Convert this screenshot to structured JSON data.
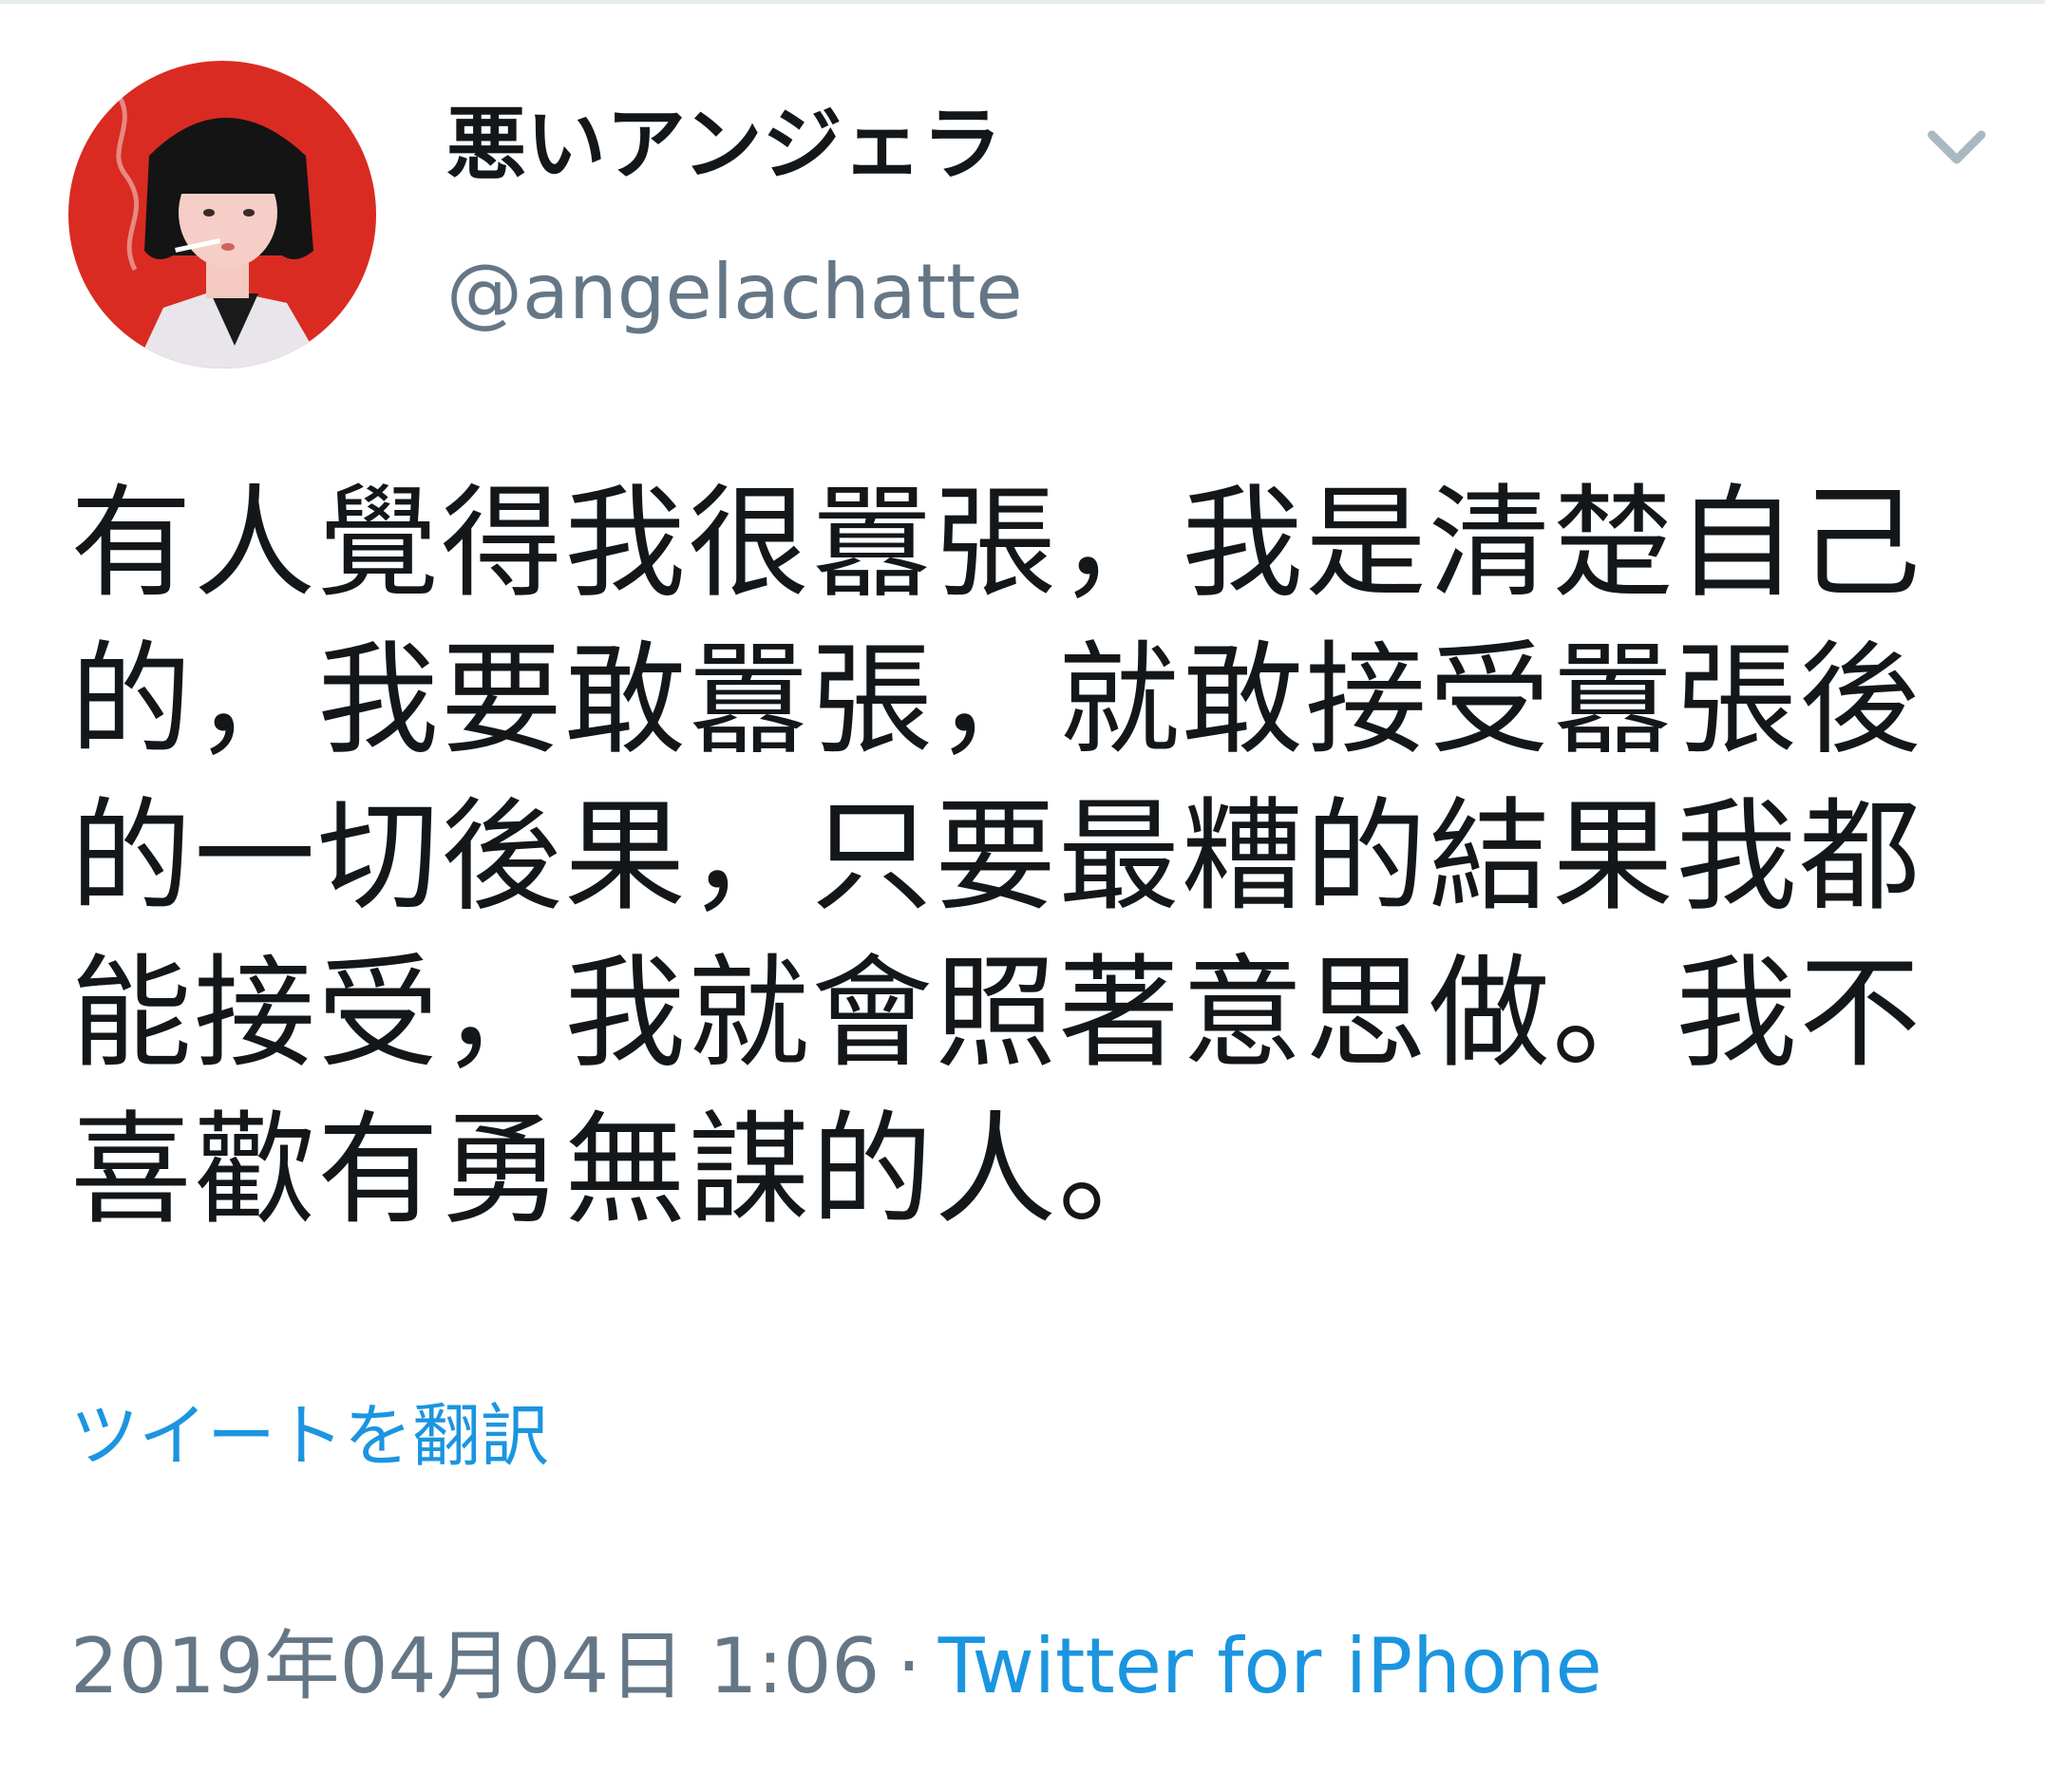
{
  "user": {
    "display_name": "悪いアンジェラ",
    "handle": "@angelachatte",
    "avatar_icon": "profile-photo"
  },
  "menu": {
    "icon": "chevron-down-icon"
  },
  "tweet": {
    "text": "有人覺得我很囂張，我是清楚自己的，我要敢囂張，就敢接受囂張後的一切後果，只要最糟的結果我都能接受，我就會照著意思做。我不喜歡有勇無謀的人。",
    "translate_label": "ツイートを翻訳",
    "timestamp": "2019年04月04日 1:06",
    "separator": "·",
    "source": "Twitter for iPhone"
  },
  "colors": {
    "text_primary": "#14171a",
    "text_secondary": "#657786",
    "link": "#1b95e0",
    "avatar_background": "#d92b22"
  }
}
